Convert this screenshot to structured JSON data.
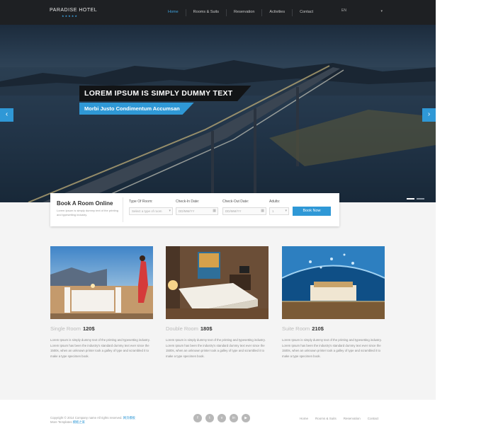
{
  "header": {
    "logo": "PARADISE HOTEL",
    "logo_stars": "★★★★★",
    "nav": [
      "Home",
      "Rooms & Suits",
      "Reservation",
      "Activities",
      "Contact"
    ],
    "active_nav": "Home",
    "language": "EN"
  },
  "hero": {
    "title": "LOREM IPSUM IS SIMPLY DUMMY TEXT",
    "subtitle": "Morbi Justo Condimentum Accumsan",
    "prev_icon": "chevron-left-icon",
    "next_icon": "chevron-right-icon"
  },
  "booking": {
    "title": "Book A Room Online",
    "description": "Lorem Ipsum is simply dummy text of the printing and typesetting industry.",
    "type_label": "Type Of Room:",
    "type_placeholder": "Select a type of room",
    "checkin_label": "Check-In Date:",
    "checkin_placeholder": "DD/MM/YY",
    "checkout_label": "Check-Out Date:",
    "checkout_placeholder": "DD/MM/YY",
    "adults_label": "Adults:",
    "adults_value": "1",
    "button": "Book Now"
  },
  "rooms": [
    {
      "name": "Single Room",
      "price": "120$",
      "description": "Lorem Ipsum is simply dummy text of the printing and typesetting industry. Lorem Ipsum has been the industry's standard dummy text ever since the 1500s, when an unknown printer took a galley of type and scrambled it to make a type specimen book."
    },
    {
      "name": "Double Room",
      "price": "180$",
      "description": "Lorem Ipsum is simply dummy text of the printing and typesetting industry. Lorem Ipsum has been the industry's standard dummy text ever since the 1500s, when an unknown printer took a galley of type and scrambled it to make a type specimen book."
    },
    {
      "name": "Suite Room",
      "price": "210$",
      "description": "Lorem Ipsum is simply dummy text of the printing and typesetting industry. Lorem Ipsum has been the industry's standard dummy text ever since the 1500s, when an unknown printer took a galley of type and scrambled it to make a type specimen book."
    }
  ],
  "footer": {
    "copyright": "Copyright © 2014 Company name All rights reserved.",
    "link_text": "网页模板",
    "more": "More Templates",
    "more_link": "模板之家",
    "social": [
      "f",
      "t",
      "v",
      "in",
      "▶"
    ],
    "nav": [
      "Home",
      "Rooms & Suits",
      "Reservation",
      "Contact"
    ]
  },
  "colors": {
    "accent": "#2f98d6",
    "header_bg": "#1e2023",
    "page_bg": "#f4f4f4"
  }
}
